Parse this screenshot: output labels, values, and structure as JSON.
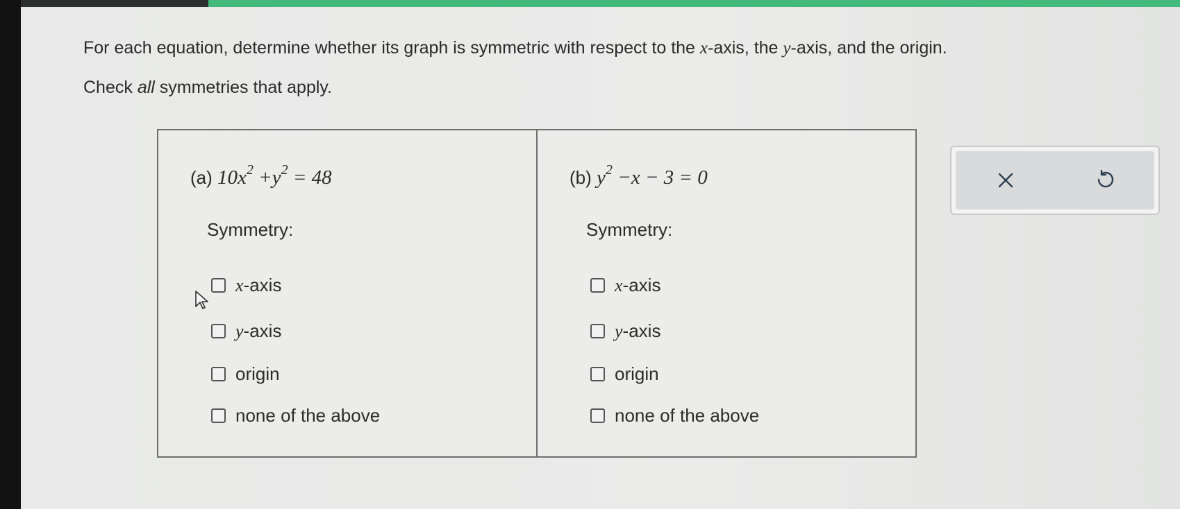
{
  "instructions": {
    "line1_a": "For each equation, determine whether its graph is symmetric with respect to the ",
    "x_var": "x",
    "line1_b": "-axis, the ",
    "y_var": "y",
    "line1_c": "-axis, and the origin.",
    "line2_a": "Check ",
    "line2_em": "all",
    "line2_b": " symmetries that apply."
  },
  "parts": [
    {
      "label": "(a)",
      "eq_pre": "10x",
      "eq_exp1": "2",
      "eq_mid": " +y",
      "eq_exp2": "2",
      "eq_post": " = 48",
      "symmetry_label": "Symmetry:",
      "options": [
        {
          "var": "x",
          "text": "-axis",
          "checked": false
        },
        {
          "var": "y",
          "text": "-axis",
          "checked": false
        },
        {
          "var": "",
          "text": "origin",
          "checked": false
        },
        {
          "var": "",
          "text": "none of the above",
          "checked": false
        }
      ]
    },
    {
      "label": "(b)",
      "eq_pre": "y",
      "eq_exp1": "2",
      "eq_mid": " −x − 3 = 0",
      "symmetry_label": "Symmetry:",
      "options": [
        {
          "var": "x",
          "text": "-axis",
          "checked": false
        },
        {
          "var": "y",
          "text": "-axis",
          "checked": false
        },
        {
          "var": "",
          "text": "origin",
          "checked": false
        },
        {
          "var": "",
          "text": "none of the above",
          "checked": false
        }
      ]
    }
  ],
  "actions": {
    "clear": "×",
    "undo": "↺"
  },
  "icons": [
    "close-icon",
    "undo-icon",
    "mouse-cursor-icon"
  ]
}
